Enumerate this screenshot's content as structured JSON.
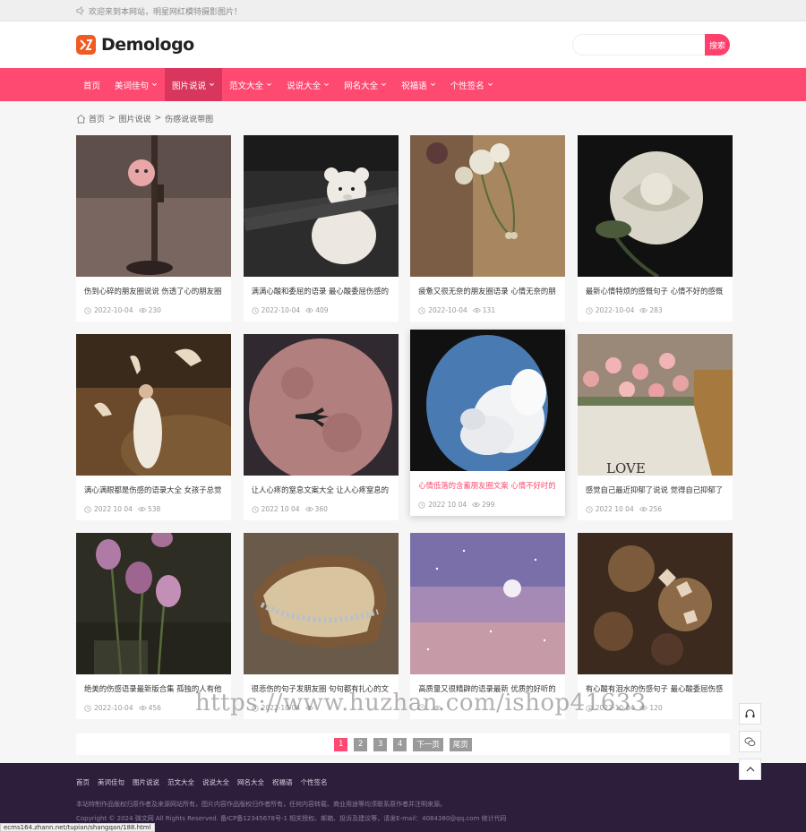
{
  "topbar": {
    "welcome": "欢迎来到本网站，明星网红模特摄影图片！"
  },
  "header": {
    "logo_text": "Demologo",
    "search_placeholder": "",
    "search_button": "搜索"
  },
  "nav": [
    {
      "label": "首页"
    },
    {
      "label": "美词佳句"
    },
    {
      "label": "图片说说"
    },
    {
      "label": "范文大全"
    },
    {
      "label": "说说大全"
    },
    {
      "label": "网名大全"
    },
    {
      "label": "祝福语"
    },
    {
      "label": "个性签名"
    }
  ],
  "breadcrumb": {
    "home": "首页",
    "sep1": ">",
    "cat": "图片说说",
    "sep2": ">",
    "current": "伤感说说带图"
  },
  "cards": [
    {
      "title": "伤到心碎的朋友圈说说 伤透了心的朋友圈",
      "date": "2022-10-04",
      "views": "230",
      "theme": "lamp"
    },
    {
      "title": "满满心酸和委屈的语录 最心酸委屈伤感的",
      "date": "2022-10-04",
      "views": "409",
      "theme": "bear"
    },
    {
      "title": "疲惫又很无奈的朋友圈语录 心情无奈的朋",
      "date": "2022-10-04",
      "views": "131",
      "theme": "flowers"
    },
    {
      "title": "最新心情特烦的感慨句子 心情不好的感慨",
      "date": "2022-10-04",
      "views": "283",
      "theme": "rose"
    },
    {
      "title": "满心满眼都是伤感的语录大全 女孩子总觉",
      "date": "2022 10 04",
      "views": "538",
      "theme": "bride"
    },
    {
      "title": "让人心疼的窒息文案大全 让人心疼窒息的",
      "date": "2022 10 04",
      "views": "360",
      "theme": "moonplane"
    },
    {
      "title": "心情低落的含蓄朋友圈文案 心情不好时的",
      "date": "2022 10 04",
      "views": "299",
      "theme": "cloud"
    },
    {
      "title": "感觉自己最近抑郁了说说 觉得自己抑郁了",
      "date": "2022 10 04",
      "views": "256",
      "theme": "bouquet"
    },
    {
      "title": "绝美的伤感语录最新版合集 孤独的人有他",
      "date": "2022-10-04",
      "views": "456",
      "theme": "tulip"
    },
    {
      "title": "很悲伤的句子发朋友圈 句句都有扎心的文",
      "date": "2022-10-04",
      "views": "",
      "theme": "bread"
    },
    {
      "title": "高质量又很精辟的语录最新 优质的好听的",
      "date": "",
      "views": "",
      "theme": "sky"
    },
    {
      "title": "有心酸有泪水的伤感句子 最心酸委屈伤感",
      "date": "2022-10-04",
      "views": "120",
      "theme": "dried"
    }
  ],
  "pager": {
    "p1": "1",
    "p2": "2",
    "p3": "3",
    "p4": "4",
    "next": "下一页",
    "last": "尾页"
  },
  "footer": {
    "links": [
      "首页",
      "美词佳句",
      "图片说说",
      "范文大全",
      "说说大全",
      "网名大全",
      "祝福语",
      "个性签名"
    ],
    "notice": "本站特制作品版权归原作者及来源网站所有，图片内容作品版权归作者所有，任何内容转载、商业用途等均须联系原作者并注明来源。",
    "copyright": "Copyright © 2024 弹文网 All Rights Reserved. 备ICP备12345678号-1 相关授权、邮箱、投诉及建议等，请发E-mail：4084380@qq.com 统计代码"
  },
  "statusbar": "ecms164.zhann.net/tupian/shangqan/188.html",
  "watermark": "https://www.huzhan.com/ishop41633",
  "colors": {
    "accent": "#fe4a70",
    "nav_active": "#d8365c",
    "footer_bg": "#2d1f3c"
  }
}
